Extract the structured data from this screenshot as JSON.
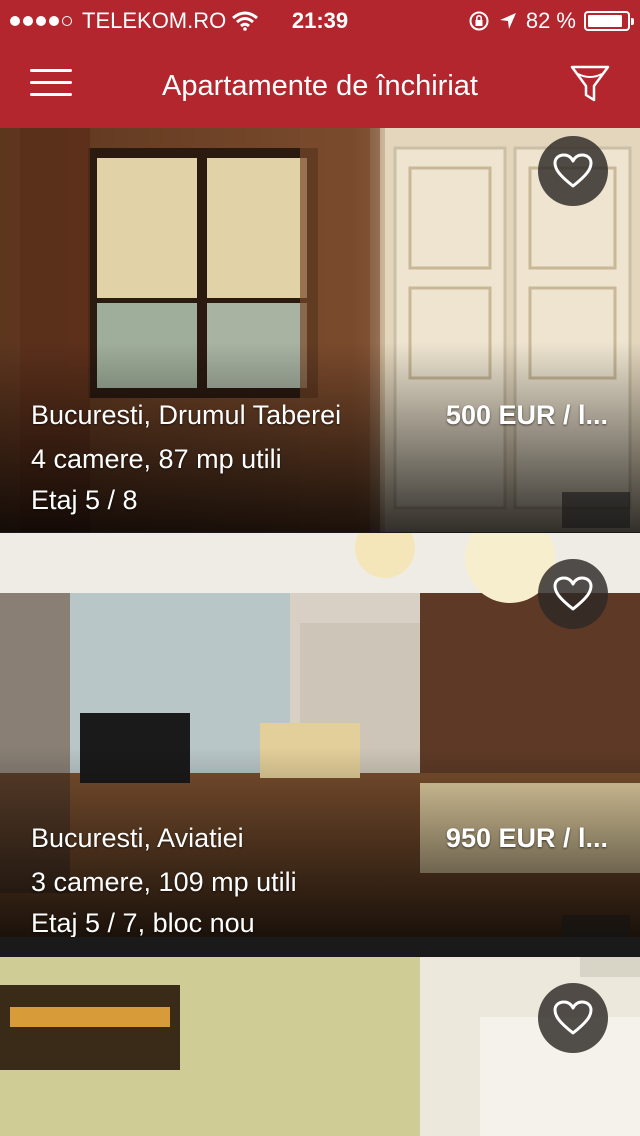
{
  "status_bar": {
    "carrier": "TELEKOM.RO",
    "time": "21:39",
    "battery_text": "82 %",
    "battery_level": 0.82,
    "signal_dots_filled": 4,
    "signal_dots_total": 5
  },
  "nav": {
    "title": "Apartamente de închiriat",
    "menu_icon": "hamburger-menu-icon",
    "filter_icon": "filter-funnel-icon"
  },
  "colors": {
    "header": "#b3262e",
    "text": "#ffffff"
  },
  "listings": [
    {
      "location": "Bucuresti, Drumul Taberei",
      "price": "500 EUR / l...",
      "details": "4 camere, 87 mp utili",
      "floor": "Etaj 5 / 8",
      "favorite_icon": "heart-outline-icon"
    },
    {
      "location": "Bucuresti, Aviatiei",
      "price": "950 EUR / l...",
      "details": "3 camere, 109 mp utili",
      "floor": "Etaj 5 / 7, bloc nou",
      "favorite_icon": "heart-outline-icon"
    },
    {
      "location": "",
      "price": "",
      "details": "",
      "floor": "",
      "favorite_icon": "heart-outline-icon"
    }
  ]
}
